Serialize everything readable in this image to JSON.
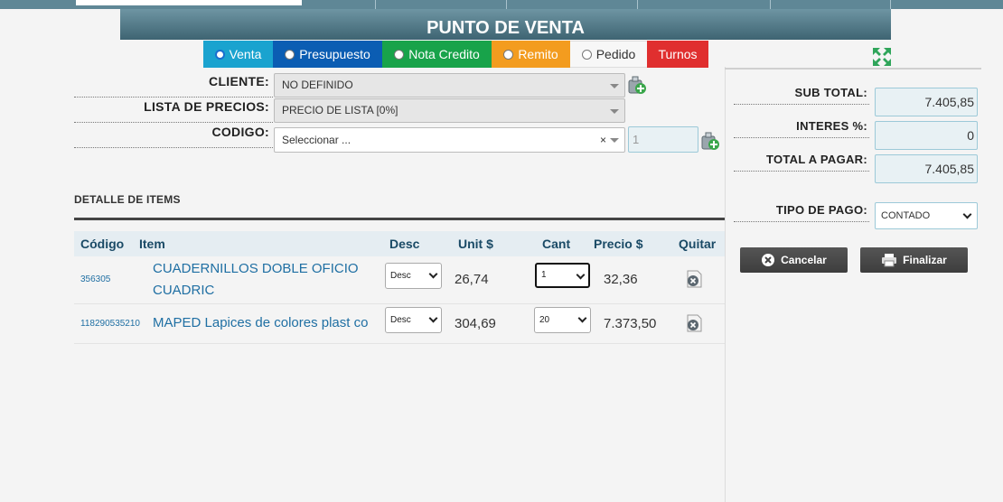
{
  "banner": {
    "title": "PUNTO DE VENTA"
  },
  "tabs": [
    {
      "label": "Venta",
      "has_radio": true
    },
    {
      "label": "Presupuesto",
      "has_radio": true
    },
    {
      "label": "Nota Credito",
      "has_radio": true
    },
    {
      "label": "Remito",
      "has_radio": true
    },
    {
      "label": "Pedido",
      "has_radio": true
    },
    {
      "label": "Turnos",
      "has_radio": false
    }
  ],
  "form": {
    "cliente_label": "CLIENTE:",
    "cliente_value": "NO DEFINIDO",
    "lista_label": "LISTA DE PRECIOS:",
    "lista_value": "PRECIO DE LISTA [0%]",
    "codigo_label": "CODIGO:",
    "codigo_placeholder": "Seleccionar ...",
    "codigo_clear": "×",
    "qty_placeholder": "1"
  },
  "detail": {
    "title": "DETALLE DE ITEMS",
    "headers": {
      "codigo": "Código",
      "item": "Item",
      "desc": "Desc",
      "unit": "Unit $",
      "cant": "Cant",
      "precio": "Precio $",
      "quitar": "Quitar"
    },
    "rows": [
      {
        "code": "356305",
        "item_line1": "CUADERNILLOS DOBLE OFICIO",
        "item_line2": "CUADRIC",
        "desc": "Desc",
        "unit": "26,74",
        "cant": "1",
        "precio": "32,36"
      },
      {
        "code": "118290535210",
        "item_line1": "MAPED Lapices de colores plast co",
        "item_line2": "",
        "desc": "Desc",
        "unit": "304,69",
        "cant": "20",
        "precio": "7.373,50"
      }
    ]
  },
  "totals": {
    "subtotal_label": "SUB TOTAL:",
    "subtotal_value": "7.405,85",
    "interes_label": "INTERES %:",
    "interes_value": "0",
    "total_label": "TOTAL A PAGAR:",
    "total_value": "7.405,85",
    "tipo_pago_label": "TIPO DE PAGO:",
    "tipo_pago_value": "CONTADO"
  },
  "actions": {
    "cancel_label": "Cancelar",
    "finalize_label": "Finalizar"
  },
  "colors": {
    "venta": "#1aa3cf",
    "presupuesto": "#0b5db3",
    "nota_credito": "#18a34a",
    "remito": "#f39c1f",
    "pedido": "#f7f7f7",
    "turnos": "#e02f2f",
    "link": "#1f6fa3"
  }
}
